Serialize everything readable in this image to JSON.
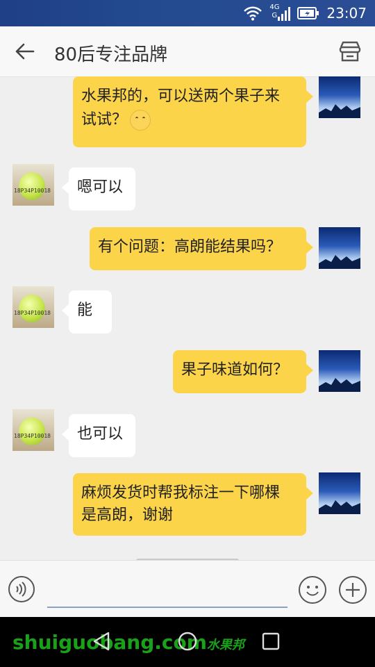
{
  "status_bar": {
    "network_label_top": "4G",
    "network_label_bottom": "G",
    "time": "23:07",
    "icons": [
      "wifi-icon",
      "cellular-signal-icon",
      "battery-icon"
    ]
  },
  "app_bar": {
    "title": "80后专注品牌",
    "icons": [
      "back-arrow-icon",
      "store-icon"
    ]
  },
  "messages": [
    {
      "sender": "me",
      "lines": [
        "水果邦的，可以送两个果子来",
        "试试？"
      ],
      "emoji": "embarrassed-face-emoji"
    },
    {
      "sender": "other",
      "lines": [
        "嗯可以"
      ]
    },
    {
      "sender": "me",
      "lines": [
        "有个问题：高朗能结果吗？"
      ]
    },
    {
      "sender": "other",
      "lines": [
        "能"
      ]
    },
    {
      "sender": "me",
      "lines": [
        "果子味道如何？"
      ]
    },
    {
      "sender": "other",
      "lines": [
        "也可以"
      ]
    },
    {
      "sender": "me",
      "lines": [
        "麻烦发货时帮我标注一下哪棵",
        "是高朗，谢谢"
      ]
    }
  ],
  "avatars": {
    "other_label": "18P34P10018"
  },
  "input_bar": {
    "icons": [
      "voice-icon",
      "emoji-icon",
      "plus-icon"
    ]
  },
  "nav_bar": {
    "icons": [
      "back-triangle-icon",
      "home-circle-icon",
      "recents-square-icon"
    ]
  },
  "watermark": {
    "text": "shuiguobang",
    "suffix": ".com",
    "cn": "水果邦"
  }
}
